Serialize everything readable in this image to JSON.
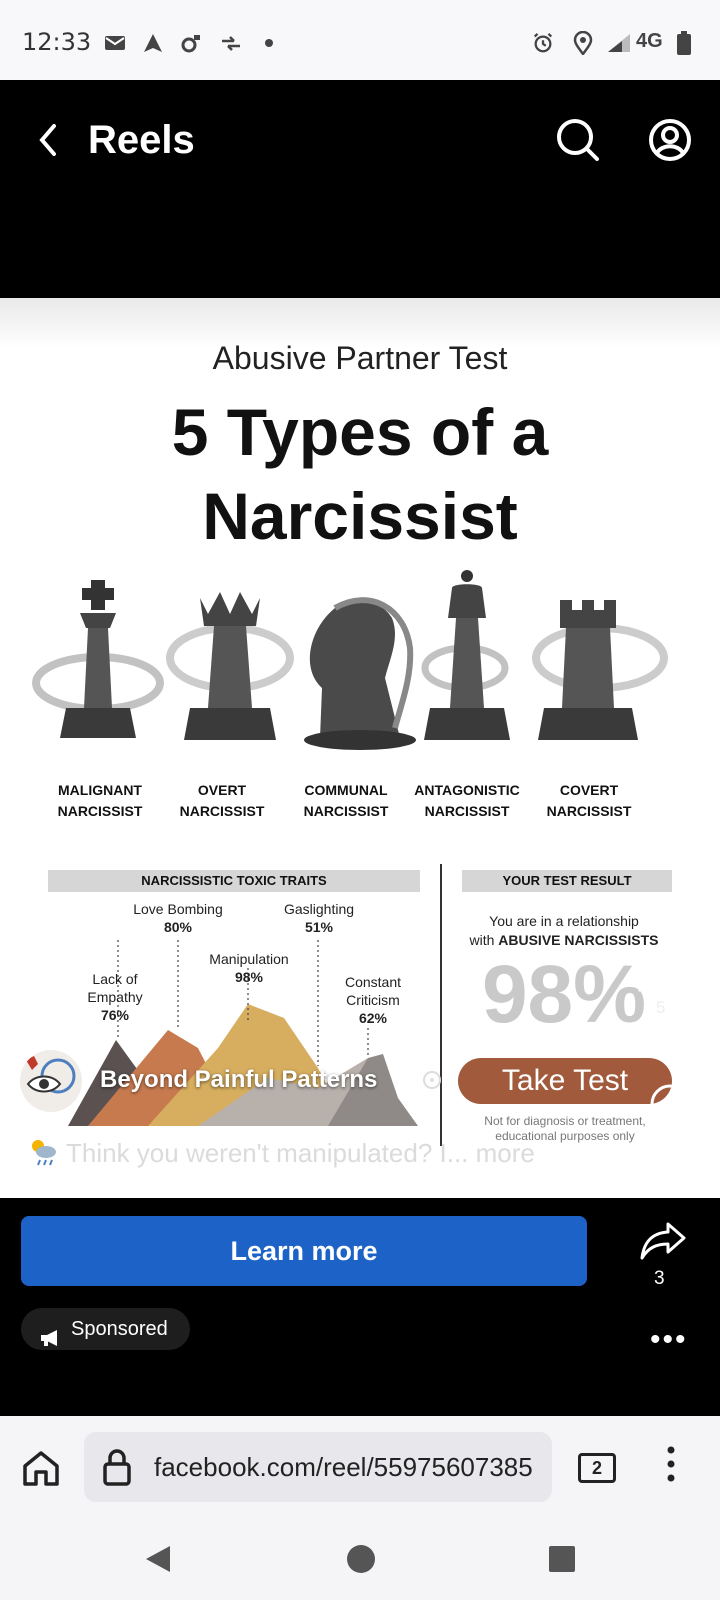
{
  "status_bar": {
    "time": "12:33",
    "network": "4G"
  },
  "header": {
    "title": "Reels"
  },
  "post": {
    "subtitle": "Abusive Partner Test",
    "headline_line1": "5 Types of a",
    "headline_line2": "Narcissist",
    "pieces": [
      {
        "line1": "MALIGNANT",
        "line2": "NARCISSIST"
      },
      {
        "line1": "OVERT",
        "line2": "NARCISSIST"
      },
      {
        "line1": "COMMUNAL",
        "line2": "NARCISSIST"
      },
      {
        "line1": "ANTAGONISTIC",
        "line2": "NARCISSIST"
      },
      {
        "line1": "COVERT",
        "line2": "NARCISSIST"
      }
    ],
    "traits_title": "NARCISSISTIC TOXIC TRAITS",
    "traits": [
      {
        "name": "Love Bombing",
        "pct": "80%"
      },
      {
        "name": "Gaslighting",
        "pct": "51%"
      },
      {
        "name": "Manipulation",
        "pct": "98%"
      },
      {
        "name_line1": "Lack of",
        "name_line2": "Empathy",
        "pct": "76%"
      },
      {
        "name_line1": "Constant",
        "name_line2": "Criticism",
        "pct": "62%"
      }
    ],
    "result_title": "YOUR TEST RESULT",
    "result_line1": "You are in a relationship",
    "result_line2_prefix": "with ",
    "result_line2_bold": "ABUSIVE NARCISSISTS",
    "result_pct": "98%",
    "cta": "Take Test",
    "disclaimer_line1": "Not for diagnosis or treatment,",
    "disclaimer_line2": "educational purposes only",
    "author": "Beyond Painful Patterns",
    "like_count": "5",
    "caption": "Think you weren't manipulated? I... more"
  },
  "ad": {
    "learn_more": "Learn more",
    "share_count": "3",
    "sponsored": "Sponsored"
  },
  "browser": {
    "url": "facebook.com/reel/55975607385",
    "tab_count": "2"
  },
  "colors": {
    "learn_more_bg": "#1d63c7",
    "take_test_bg": "#a15a3c"
  }
}
